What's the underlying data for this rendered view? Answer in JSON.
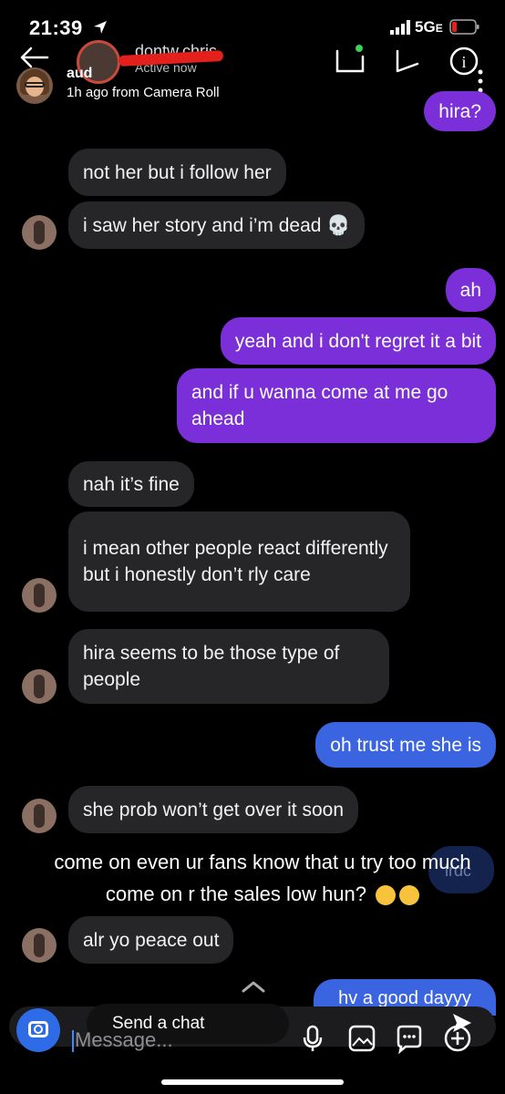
{
  "status_bar": {
    "time": "21:39",
    "network": "5G",
    "network_suffix": "E"
  },
  "header": {
    "username": "dontw.chris",
    "active_status": "Active now",
    "name": "aud",
    "subtitle": "1h ago from Camera Roll"
  },
  "messages": [
    {
      "side": "out",
      "color": "purple",
      "text": "hira?"
    },
    {
      "side": "in",
      "text": "not her but i follow her"
    },
    {
      "side": "in",
      "text": "i saw her story and i’m dead 💀"
    },
    {
      "side": "out",
      "color": "purple",
      "text": "ah"
    },
    {
      "side": "out",
      "color": "purple",
      "text": "yeah and i don't regret it a bit"
    },
    {
      "side": "out",
      "color": "purple",
      "text": "and if u wanna come at me go ahead"
    },
    {
      "side": "in",
      "text": "nah it’s fine"
    },
    {
      "side": "in",
      "text": "i mean other people react differently but i honestly don’t rly care"
    },
    {
      "side": "in",
      "text": "hira seems to be those type of people"
    },
    {
      "side": "out",
      "color": "blue",
      "text": "oh trust me she is"
    },
    {
      "side": "in",
      "text": "she prob won’t get over it soon"
    },
    {
      "side": "in",
      "text": "alr yo peace out"
    },
    {
      "side": "out",
      "color": "blue",
      "text": "hv a good dayyy"
    }
  ],
  "overlay": {
    "caption": "come on even ur fans know that u try too much come on r the sales low hun?",
    "ghost": "irdc"
  },
  "composer": {
    "send_label": "Send a chat",
    "placeholder": "Message..."
  },
  "colors": {
    "outgoing_purple": "#7a2fd8",
    "outgoing_blue": "#3a64e0",
    "incoming": "#262628",
    "background": "#000000"
  }
}
